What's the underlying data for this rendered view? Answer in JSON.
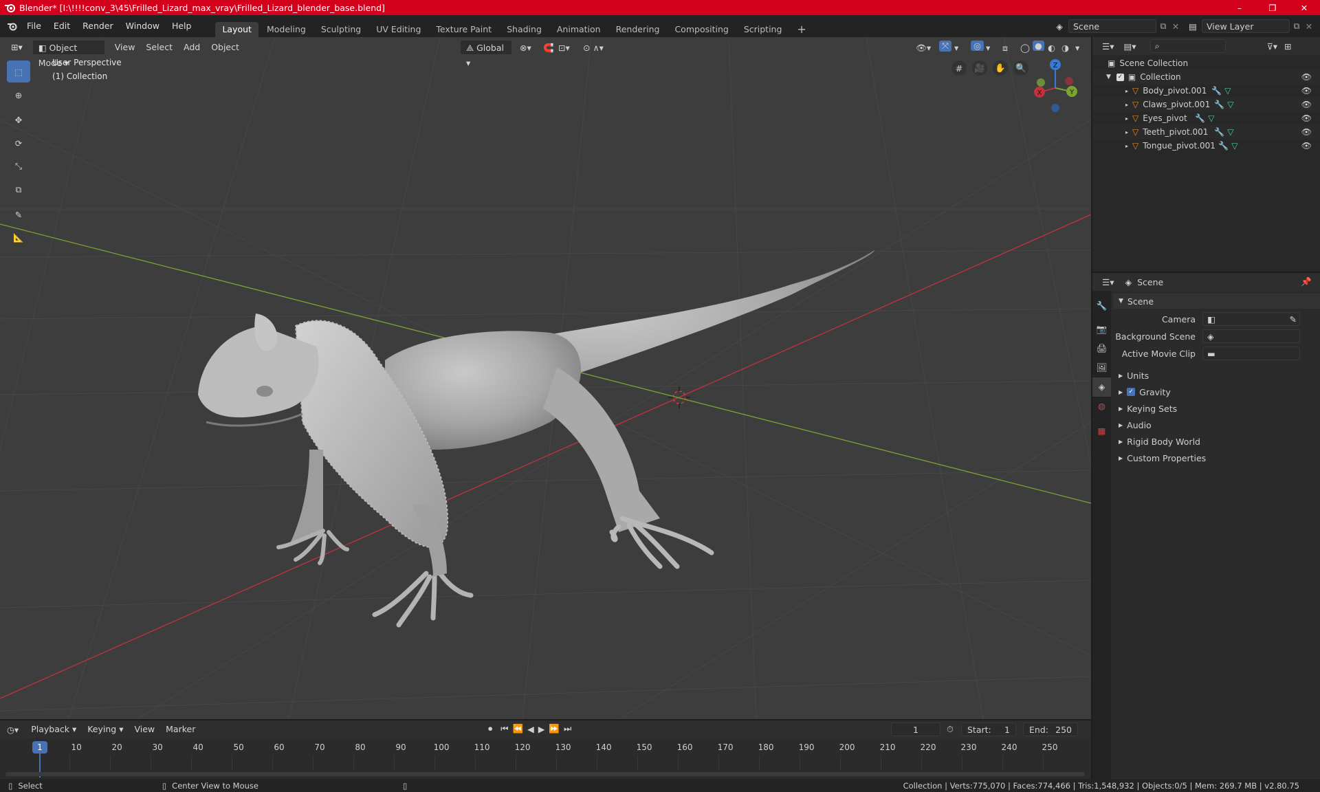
{
  "window": {
    "title": "Blender* [I:\\!!!!conv_3\\45\\Frilled_Lizard_max_vray\\Frilled_Lizard_blender_base.blend]",
    "minimize": "–",
    "maximize": "❐",
    "close": "✕"
  },
  "menu": [
    "File",
    "Edit",
    "Render",
    "Window",
    "Help"
  ],
  "workspaces": [
    "Layout",
    "Modeling",
    "Sculpting",
    "UV Editing",
    "Texture Paint",
    "Shading",
    "Animation",
    "Rendering",
    "Compositing",
    "Scripting"
  ],
  "active_workspace": "Layout",
  "add_workspace": "+",
  "scene_field": "Scene",
  "view_layer_field": "View Layer",
  "viewport": {
    "mode": "Object Mode",
    "menus": [
      "View",
      "Select",
      "Add",
      "Object"
    ],
    "orientation": "Global",
    "overlay_title": "User Perspective",
    "overlay_collection": "(1) Collection",
    "gizmo": {
      "x": "X",
      "y": "Y",
      "z": "Z"
    }
  },
  "outliner": {
    "search_placeholder": "",
    "root": "Scene Collection",
    "collection": "Collection",
    "items": [
      "Body_pivot.001",
      "Claws_pivot.001",
      "Eyes_pivot",
      "Teeth_pivot.001",
      "Tongue_pivot.001"
    ]
  },
  "properties": {
    "header": "Scene",
    "panel": "Scene",
    "camera_label": "Camera",
    "background_label": "Background Scene",
    "clip_label": "Active Movie Clip",
    "sections": [
      "Units",
      "Gravity",
      "Keying Sets",
      "Audio",
      "Rigid Body World",
      "Custom Properties"
    ],
    "gravity_checked": true
  },
  "timeline": {
    "menus": [
      "Playback",
      "Keying",
      "View",
      "Marker"
    ],
    "current_frame": "1",
    "start_label": "Start:",
    "start": "1",
    "end_label": "End:",
    "end": "250",
    "ticks": [
      1,
      10,
      20,
      30,
      40,
      50,
      60,
      70,
      80,
      90,
      100,
      110,
      120,
      130,
      140,
      150,
      160,
      170,
      180,
      190,
      200,
      210,
      220,
      230,
      240,
      250
    ]
  },
  "status": {
    "left": "Select",
    "middle": "Center View to Mouse",
    "right": "Collection | Verts:775,070 | Faces:774,466 | Tris:1,548,932 | Objects:0/5 | Mem: 269.7 MB | v2.80.75"
  },
  "colors": {
    "titlebar": "#d3011c",
    "accent": "#4772b3",
    "x_axis": "#c2323e",
    "y_axis": "#7aa431",
    "object_orange": "#e38c28",
    "modifier_blue": "#6aa7e0",
    "mesh_green": "#4fc9a4"
  }
}
